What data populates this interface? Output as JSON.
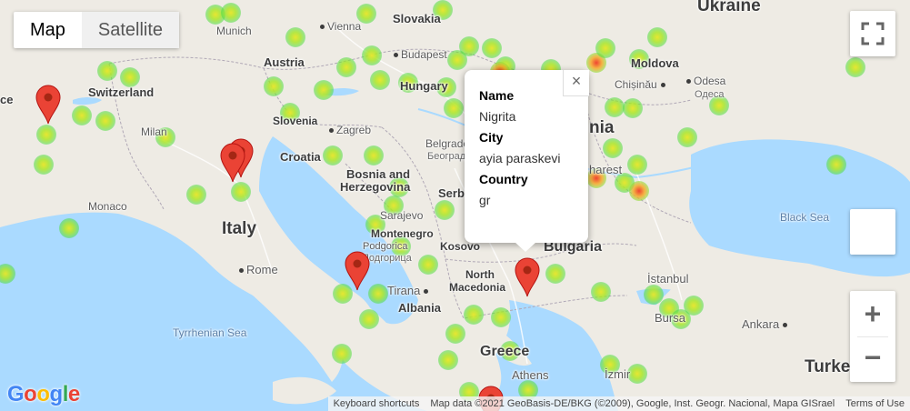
{
  "map_type": {
    "map_label": "Map",
    "satellite_label": "Satellite",
    "selected": "Map"
  },
  "labels": {
    "ukraine": "Ukraine",
    "slovakia": "Slovakia",
    "vienna": "Vienna",
    "munich": "Munich",
    "austria": "Austria",
    "budapest": "Budapest",
    "hungary": "Hungary",
    "moldova": "Moldova",
    "chisinau": "Chișinău",
    "odesa": "Odesa",
    "odesa_cyr": "Одеса",
    "switzerland": "Switzerland",
    "france_edge": "ce",
    "slovenia": "Slovenia",
    "zagreb": "Zagreb",
    "milan": "Milan",
    "croatia": "Croatia",
    "belgrade": "Belgrade",
    "belgrade_cyr": "Београд",
    "serbia": "Serb",
    "bosnia1": "Bosnia and",
    "bosnia2": "Herzegovina",
    "sarajevo": "Sarajevo",
    "montenegro": "Montenegro",
    "podgorica": "Podgorica",
    "podgorica_cyr": "Подгорица",
    "kosovo": "Kosovo",
    "monaco": "Monaco",
    "italy": "Italy",
    "rome": "Rome",
    "tirana": "Tirana",
    "albania": "Albania",
    "north_macedonia1": "North",
    "north_macedonia2": "Macedonia",
    "bulgaria": "Bulgaria",
    "black_sea": "Black Sea",
    "istanbul": "İstanbul",
    "bursa": "Bursa",
    "ankara": "Ankara",
    "tyrrhenian": "Tyrrhenian Sea",
    "greece": "Greece",
    "athens": "Athens",
    "izmir": "İzmir",
    "turkey": "Turke",
    "romania_partial": "nia",
    "bucharest_partial": "harest"
  },
  "info_window": {
    "name_label": "Name",
    "name_value": "Nigrita",
    "city_label": "City",
    "city_value": "ayia paraskevi",
    "country_label": "Country",
    "country_value": "gr",
    "close_glyph": "×"
  },
  "controls": {
    "fullscreen_icon": "fullscreen-icon",
    "zoom_in": "+",
    "zoom_out": "−"
  },
  "footer": {
    "keyboard_shortcuts": "Keyboard shortcuts",
    "map_data": "Map data ©2021 GeoBasis-DE/BKG (©2009), Google, Inst. Geogr. Nacional, Mapa GISrael",
    "terms": "Terms of Use"
  },
  "logo_text": "Google",
  "colors": {
    "marker": "#ea4335",
    "marker_dark": "#a52714",
    "land": "#eeebe4",
    "sea": "#aadaff",
    "heat_core": "#e6e628",
    "heat_edge": "#50dc3c"
  }
}
